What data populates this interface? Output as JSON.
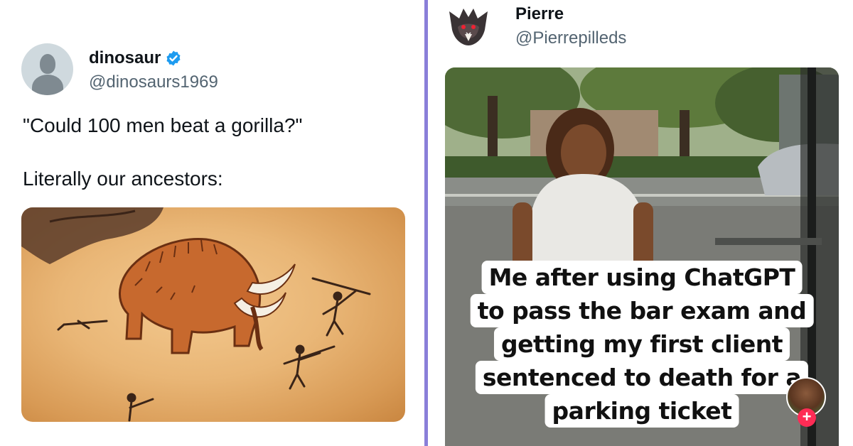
{
  "left_tweet": {
    "display_name": "dinosaur",
    "handle": "@dinosaurs1969",
    "text_line1": "\"Could 100 men beat a gorilla?\"",
    "text_line2": "Literally our ancestors:",
    "verified": true,
    "avatar_icon": "default-profile-icon",
    "media_icon": "cave-painting-mammoth"
  },
  "right_tweet": {
    "display_name": "Pierre",
    "handle": "@Pierrepilleds",
    "avatar_icon": "cartoon-creature-avatar",
    "video_caption": [
      "Me after using ChatGPT",
      "to pass the bar exam and",
      "getting my first client",
      "sentenced to death for a",
      "parking ticket"
    ],
    "follow_plus": "+"
  },
  "colors": {
    "divider": "#8a7fd9",
    "verified_blue": "#1d9bf0",
    "handle_gray": "#536471",
    "plus_pink": "#fe2c55"
  }
}
